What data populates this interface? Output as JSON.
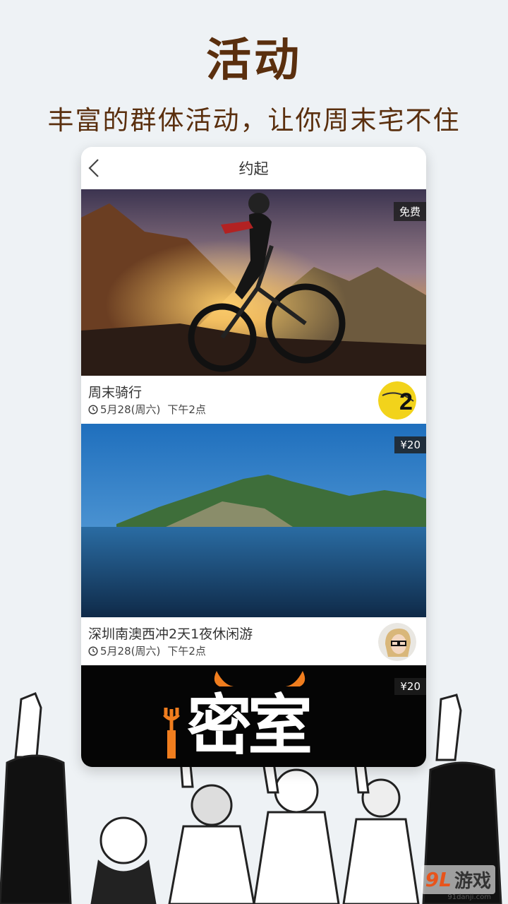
{
  "hero": {
    "title": "活动",
    "subtitle": "丰富的群体活动，让你周末宅不住"
  },
  "screen": {
    "nav_title": "约起",
    "back_icon": "chevron-left-icon"
  },
  "activities": [
    {
      "price": "免费",
      "title": "周末骑行",
      "date": "5月28(周六)",
      "time": "下午2点",
      "avatar": "yellow-ball-2-avatar"
    },
    {
      "price": "¥20",
      "title": "深圳南澳西冲2天1夜休闲游",
      "date": "5月28(周六)",
      "time": "下午2点",
      "avatar": "glasses-girl-avatar"
    },
    {
      "price": "¥20",
      "poster_text": "密室"
    }
  ],
  "watermark": {
    "logo": "9L",
    "name": "游戏",
    "site": "91danji.com"
  },
  "colors": {
    "brand_brown": "#5a2f0e",
    "poster_orange": "#f07d1e"
  }
}
